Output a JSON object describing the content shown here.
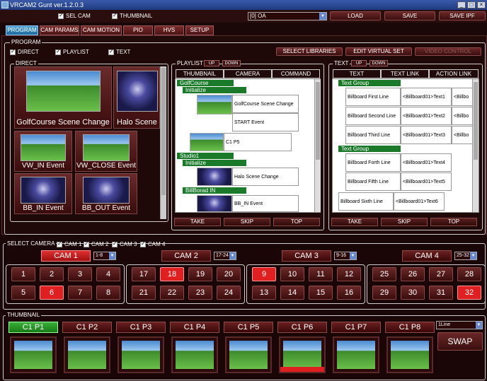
{
  "titlebar": {
    "title": "VRCAM2 Gunt ver.1.2.0.3",
    "buttons": [
      "_",
      "□",
      "×"
    ]
  },
  "topbar": {
    "sel_cam": "SEL CAM",
    "thumbnail": "THUMBNAIL",
    "select_value": "[0] OA",
    "load": "LOAD",
    "save": "SAVE",
    "save_ipf": "SAVE IPF"
  },
  "tabs": [
    "PROGRAM",
    "CAM PARAMS",
    "CAM MOTION",
    "PIO",
    "HVS",
    "SETUP"
  ],
  "program": {
    "title": "PROGRAM",
    "checks": [
      "DIRECT",
      "PLAYLIST",
      "TEXT"
    ],
    "select_libraries": "SELECT LIBRARIES",
    "edit_virtual_set": "EDIT VIRTUAL SET",
    "video_control": "VIDEO CONTROL"
  },
  "direct": {
    "title": "DIRECT",
    "items": [
      "GolfCourse Scene Change",
      "Halo Scene",
      "VW_IN Event",
      "VW_CLOSE Event",
      "BB_IN Event",
      "BB_OUT Event"
    ]
  },
  "playlist": {
    "title": "PLAYLIST",
    "up": "UP",
    "down": "DOWN",
    "headers": [
      "THUMBNAIL",
      "CAMERA",
      "COMMAND"
    ],
    "groups": [
      "GolfCourse",
      "Studio1"
    ],
    "subgroups": [
      "Initialize",
      "Initialize",
      "BillBorad IN"
    ],
    "entries": [
      "GolfCourse Scene Change",
      "START Event",
      "C1 P5",
      "Halo Scene Change",
      "BB_IN Event"
    ],
    "buttons": [
      "TAKE",
      "SKIP",
      "TOP"
    ]
  },
  "text": {
    "title": "TEXT",
    "up": "UP",
    "down": "DOWN",
    "headers": [
      "TEXT",
      "TEXT LINK",
      "ACTION LINK"
    ],
    "groups": [
      "Text Group",
      "Text Group"
    ],
    "rows": [
      {
        "text": "Billboard First Line",
        "link": "<Billboard01>Text1",
        "action": "<Billbo"
      },
      {
        "text": "Billboard Second Line",
        "link": "<Billboard01>Text2",
        "action": "<Billbo"
      },
      {
        "text": "Billboard Third Line",
        "link": "<Billboard01>Text3",
        "action": "<Billbo"
      },
      {
        "text": "Billboard Forth Line",
        "link": "<Billboard01>Text4",
        "action": ""
      },
      {
        "text": "Billboard Fifth Line",
        "link": "<Billboard01>Text5",
        "action": ""
      },
      {
        "text": "Billboard Sixth Line",
        "link": "<Billboard01>Text6",
        "action": ""
      }
    ],
    "buttons": [
      "TAKE",
      "SKIP",
      "TOP"
    ]
  },
  "select_camera": {
    "title": "SELECT CAMERA",
    "checks": [
      "CAM 1",
      "CAM 2",
      "CAM 3",
      "CAM 4"
    ],
    "cams": [
      {
        "label": "CAM 1",
        "range": "1-8"
      },
      {
        "label": "CAM 2",
        "range": "17-24"
      },
      {
        "label": "CAM 3",
        "range": "9-16"
      },
      {
        "label": "CAM 4",
        "range": "25-32"
      }
    ],
    "buttons": [
      [
        "1",
        "2",
        "3",
        "4",
        "5",
        "6",
        "7",
        "8"
      ],
      [
        "17",
        "18",
        "19",
        "20",
        "21",
        "22",
        "23",
        "24"
      ],
      [
        "9",
        "10",
        "11",
        "12",
        "13",
        "14",
        "15",
        "16"
      ],
      [
        "25",
        "26",
        "27",
        "28",
        "29",
        "30",
        "31",
        "32"
      ]
    ],
    "active": [
      "6",
      "18",
      "9",
      "32"
    ],
    "active_color": "#e02020"
  },
  "thumbnail": {
    "title": "THUMBNAIL",
    "labels": [
      "C1 P1",
      "C1 P2",
      "C1 P3",
      "C1 P4",
      "C1 P5",
      "C1 P6",
      "C1 P7",
      "C1 P8"
    ],
    "selected_label": "C1 P1",
    "selected_thumb": "C1 P6",
    "select_value": "1Line",
    "swap": "SWAP",
    "label_select_color": "#2a9a2a"
  }
}
